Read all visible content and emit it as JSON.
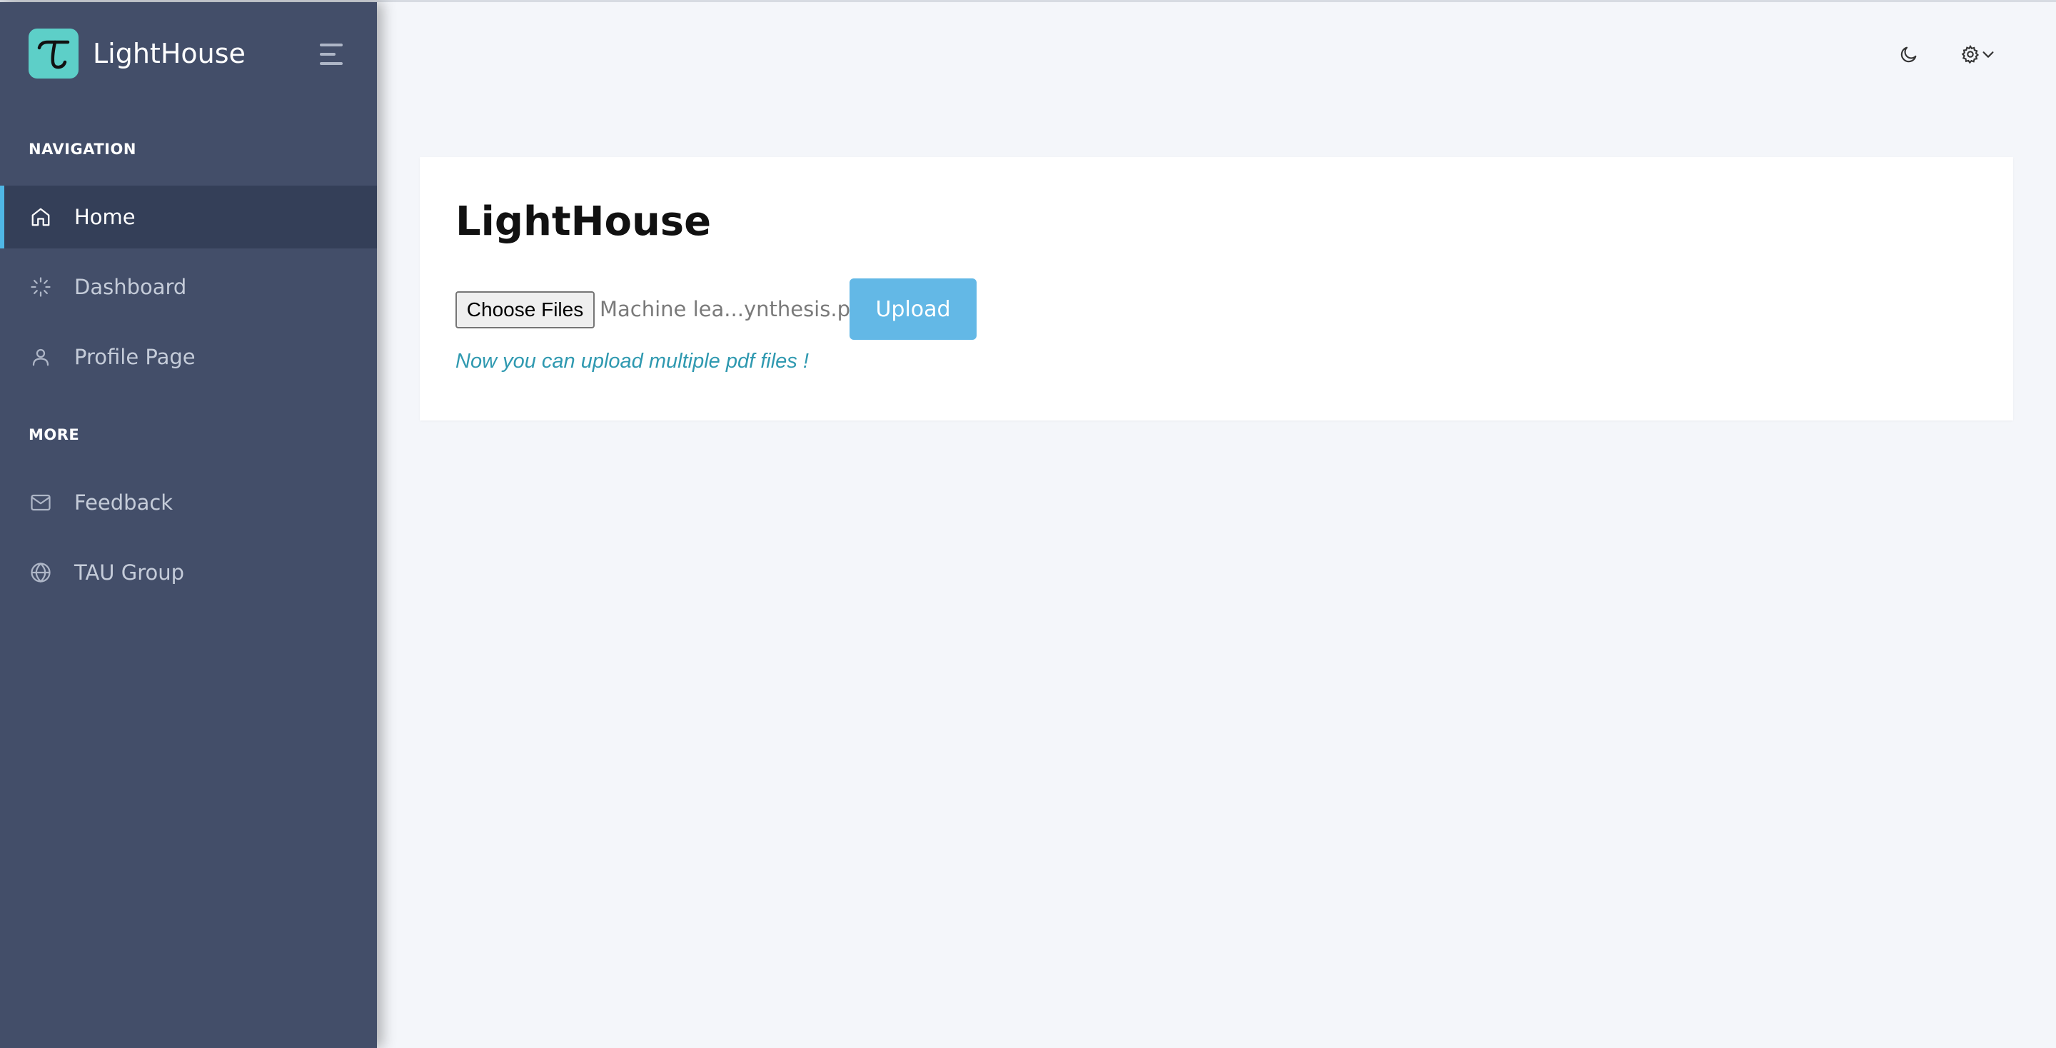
{
  "app": {
    "name": "LightHouse",
    "logo_glyph": "τ"
  },
  "sidebar": {
    "section_navigation": "NAVIGATION",
    "section_more": "MORE",
    "items": [
      {
        "label": "Home",
        "icon": "home-icon",
        "active": true
      },
      {
        "label": "Dashboard",
        "icon": "loader-icon",
        "active": false
      },
      {
        "label": "Profile Page",
        "icon": "user-icon",
        "active": false
      },
      {
        "label": "Feedback",
        "icon": "mail-icon",
        "active": false
      },
      {
        "label": "TAU Group",
        "icon": "globe-icon",
        "active": false
      }
    ]
  },
  "topbar": {
    "theme_toggle_icon": "moon-icon",
    "settings_icon": "gear-icon"
  },
  "main": {
    "title": "LightHouse",
    "choose_files_label": "Choose Files",
    "selected_file": "Machine lea...ynthesis.pdf",
    "upload_label": "Upload",
    "hint": "Now you can upload multiple pdf files !"
  },
  "colors": {
    "sidebar_bg": "#434e69",
    "sidebar_active_bg": "#343f58",
    "accent": "#4fb7e6",
    "logo_bg": "#5dcfc8",
    "upload_button": "#63b8e6",
    "hint_text": "#2f99b0"
  }
}
